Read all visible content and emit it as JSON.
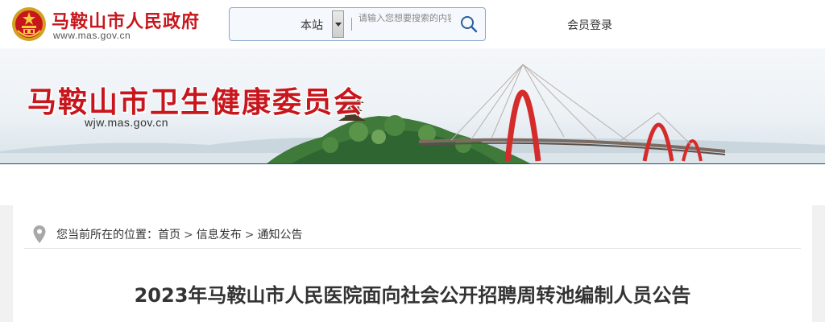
{
  "header": {
    "site_name": "马鞍山市人民政府",
    "site_domain": "www.mas.gov.cn",
    "search": {
      "scope": "本站",
      "placeholder": "请输入您想要搜索的内容"
    },
    "login_label": "会员登录"
  },
  "banner": {
    "title": "马鞍山市卫生健康委员会",
    "domain": "wjw.mas.gov.cn"
  },
  "breadcrumb": {
    "prefix": "您当前所在的位置：",
    "items": [
      "首页",
      "信息发布",
      "通知公告"
    ],
    "separator": ">"
  },
  "article": {
    "title": "2023年马鞍山市人民医院面向社会公开招聘周转池编制人员公告"
  },
  "colors": {
    "brand_red": "#c8161d",
    "banner_line": "#1a4f8a"
  }
}
